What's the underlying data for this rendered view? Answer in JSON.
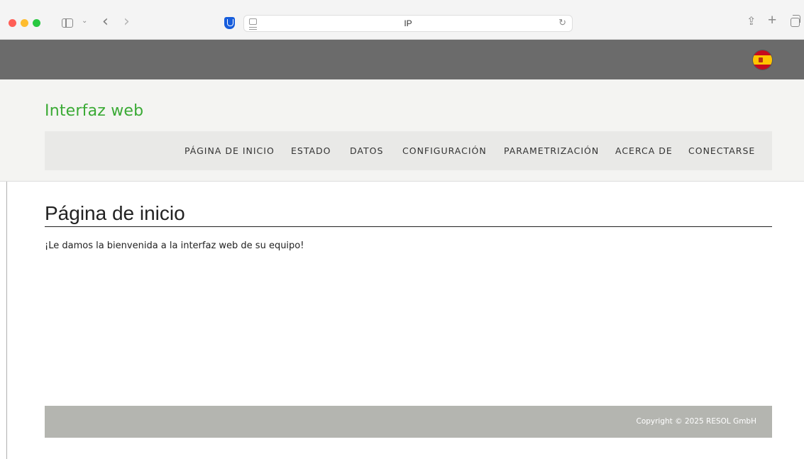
{
  "browser": {
    "address": "IP",
    "icons": [
      "sidebar-toggle-icon",
      "chevron-down-icon",
      "back-arrow-icon",
      "forward-arrow-icon",
      "bitwarden-shield-icon",
      "site-icon",
      "reload-icon",
      "share-icon",
      "plus-icon",
      "tabs-overview-icon"
    ],
    "colors": {
      "close": "#ff5f57",
      "minimize": "#febc2e",
      "zoom": "#28c840"
    }
  },
  "header": {
    "brand": "Interfaz web",
    "brand_color": "#3aaa35",
    "language_icon": "spain-flag-icon"
  },
  "nav": {
    "items": [
      {
        "label": "PÁGINA DE INICIO"
      },
      {
        "label": "ESTADO"
      },
      {
        "label": "DATOS"
      },
      {
        "label": "CONFIGURACIÓN"
      },
      {
        "label": "PARAMETRIZACIÓN"
      },
      {
        "label": "ACERCA DE"
      },
      {
        "label": "CONECTARSE"
      }
    ]
  },
  "main": {
    "title": "Página de inicio",
    "welcome": "¡Le damos la bienvenida a la interfaz web de su equipo!"
  },
  "footer": {
    "copyright": "Copyright © 2025 RESOL GmbH"
  }
}
